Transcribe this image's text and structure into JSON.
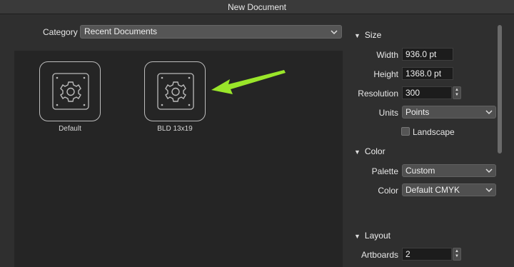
{
  "window": {
    "title": "New Document"
  },
  "category": {
    "label": "Category",
    "value": "Recent Documents"
  },
  "presets": [
    {
      "label": "Default",
      "icon": "gear-icon"
    },
    {
      "label": "BLD 13x19",
      "icon": "gear-icon"
    }
  ],
  "annotation": {
    "color": "#9ae62a"
  },
  "size": {
    "heading": "Size",
    "width_label": "Width",
    "width": "936.0 pt",
    "height_label": "Height",
    "height": "1368.0 pt",
    "resolution_label": "Resolution",
    "resolution": "300",
    "units_label": "Units",
    "units": "Points",
    "landscape_label": "Landscape"
  },
  "color": {
    "heading": "Color",
    "palette_label": "Palette",
    "palette": "Custom",
    "color_label": "Color",
    "color": "Default CMYK"
  },
  "layout": {
    "heading": "Layout",
    "artboards_label": "Artboards",
    "artboards": "2"
  }
}
